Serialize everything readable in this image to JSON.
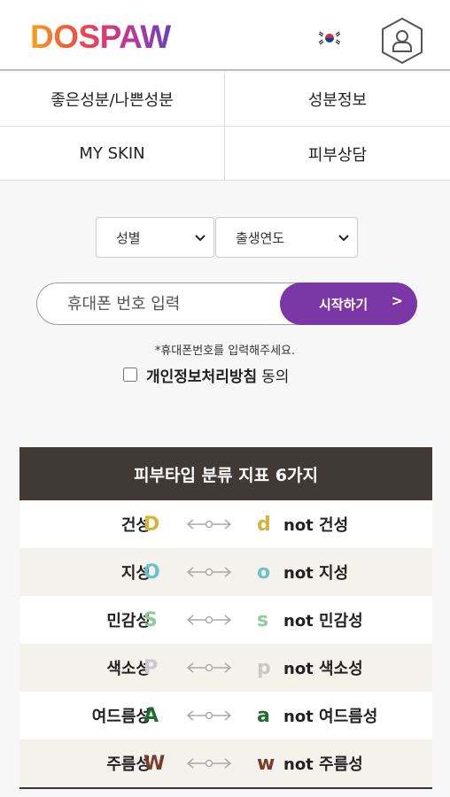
{
  "header": {
    "logo": "DOSPAW",
    "flag_icon": "korea-flag-icon",
    "user_icon": "user-profile-icon"
  },
  "nav": {
    "items": [
      {
        "label": "좋은성분/나쁜성분"
      },
      {
        "label": "성분정보"
      },
      {
        "label": "MY SKIN"
      },
      {
        "label": "피부상담"
      }
    ]
  },
  "form": {
    "gender_select": "성별",
    "birth_year_select": "출생연도",
    "phone_placeholder": "휴대폰 번호 입력",
    "start_button": "시작하기",
    "start_arrow": ">",
    "helper": "*휴대폰번호를 입력해주세요.",
    "agree_bold": "개인정보처리방침",
    "agree_rest": "동의"
  },
  "skin_table": {
    "title": "피부타입 분류 지표 6가지",
    "rows": [
      {
        "name": "건성",
        "up": "D",
        "lo": "d",
        "not": "not 건성",
        "color": "#d4b43a"
      },
      {
        "name": "지성",
        "up": "O",
        "lo": "o",
        "not": "not 지성",
        "color": "#6cc0cf"
      },
      {
        "name": "민감성",
        "up": "S",
        "lo": "s",
        "not": "not 민감성",
        "color": "#8ccc9c"
      },
      {
        "name": "색소성",
        "up": "P",
        "lo": "p",
        "not": "not 색소성",
        "color": "#c9c9c9"
      },
      {
        "name": "여드름성",
        "up": "A",
        "lo": "a",
        "not": "not 여드름성",
        "color": "#1f6e2e"
      },
      {
        "name": "주름성",
        "up": "W",
        "lo": "w",
        "not": "not 주름성",
        "color": "#7a3a2e"
      }
    ]
  },
  "colors": {
    "accent": "#7a37a5",
    "table_header": "#403936"
  }
}
